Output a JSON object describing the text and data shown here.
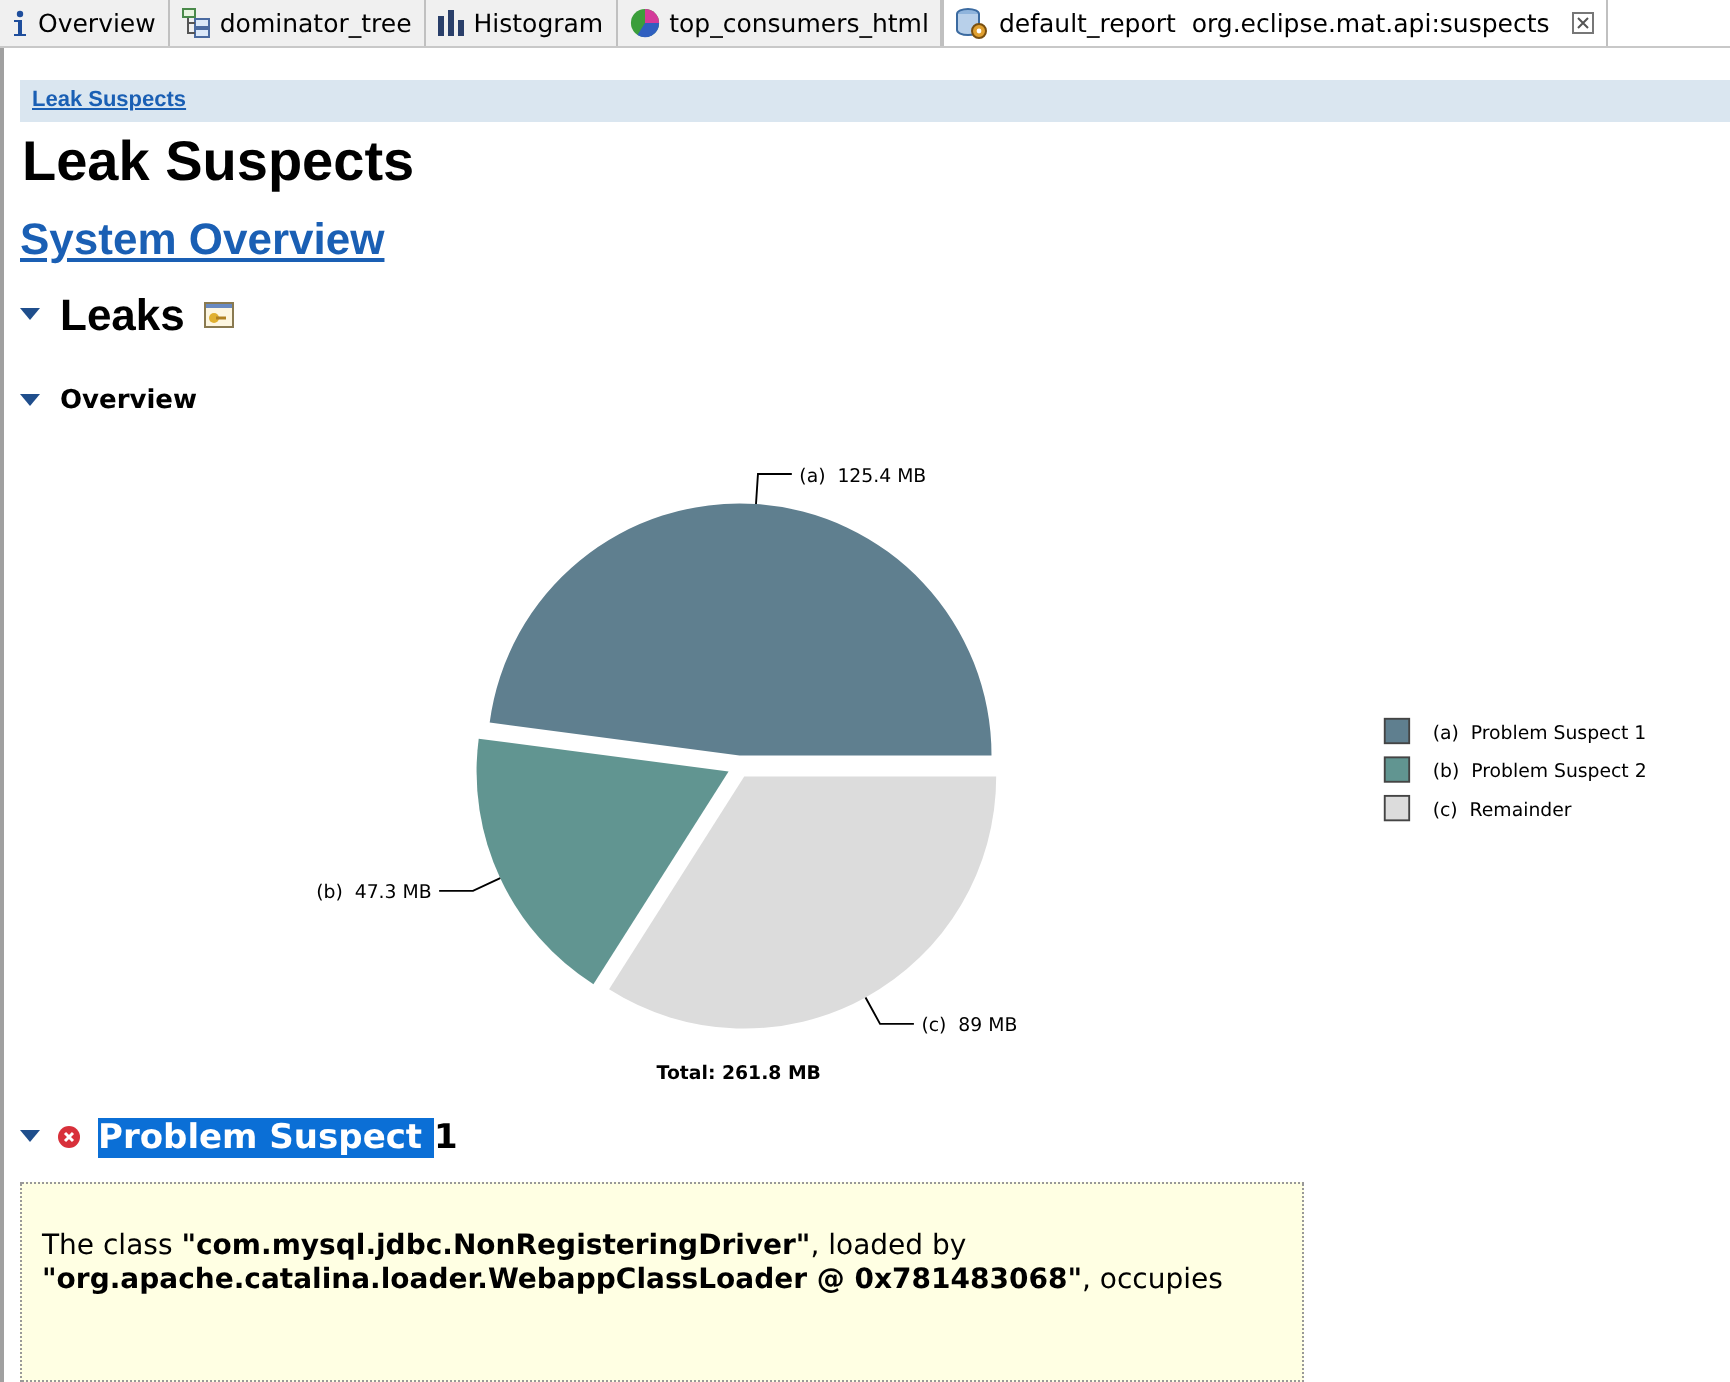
{
  "tabs": [
    {
      "kind": "info",
      "label": "Overview",
      "selected": false
    },
    {
      "kind": "tree",
      "label": "dominator_tree",
      "selected": false
    },
    {
      "kind": "histogram",
      "label": "Histogram",
      "selected": false
    },
    {
      "kind": "pie",
      "label": "top_consumers_html",
      "selected": false
    },
    {
      "kind": "report",
      "label": "default_report  org.eclipse.mat.api:suspects",
      "selected": true
    }
  ],
  "breadcrumb": "Leak Suspects",
  "title": "Leak Suspects",
  "overview_link": "System Overview",
  "leaks": {
    "heading": "Leaks",
    "expanded": true,
    "overview": {
      "heading": "Overview",
      "expanded": true,
      "chart_data": {
        "type": "pie",
        "categories": [
          "(a)  Problem Suspect 1",
          "(b)  Problem Suspect 2",
          "(c)  Remainder"
        ],
        "values": [
          125.4,
          47.3,
          89
        ],
        "colors": [
          "#5f7f8f",
          "#619591",
          "#dcdcdc"
        ],
        "legend": true,
        "value_labels": [
          "(a)  125.4 MB",
          "(b)  47.3 MB",
          "(c)  89 MB"
        ]
      },
      "total": "Total: 261.8 MB"
    }
  },
  "suspect": {
    "expanded": true,
    "highlighted": "Problem Suspect ",
    "rest": "1",
    "lines": [
      "The class **\"com.mysql.jdbc.NonRegisteringDriver\"**, loaded by",
      "**\"org.apache.catalina.loader.WebappClassLoader @ 0x781483068\"**, occupies"
    ]
  }
}
